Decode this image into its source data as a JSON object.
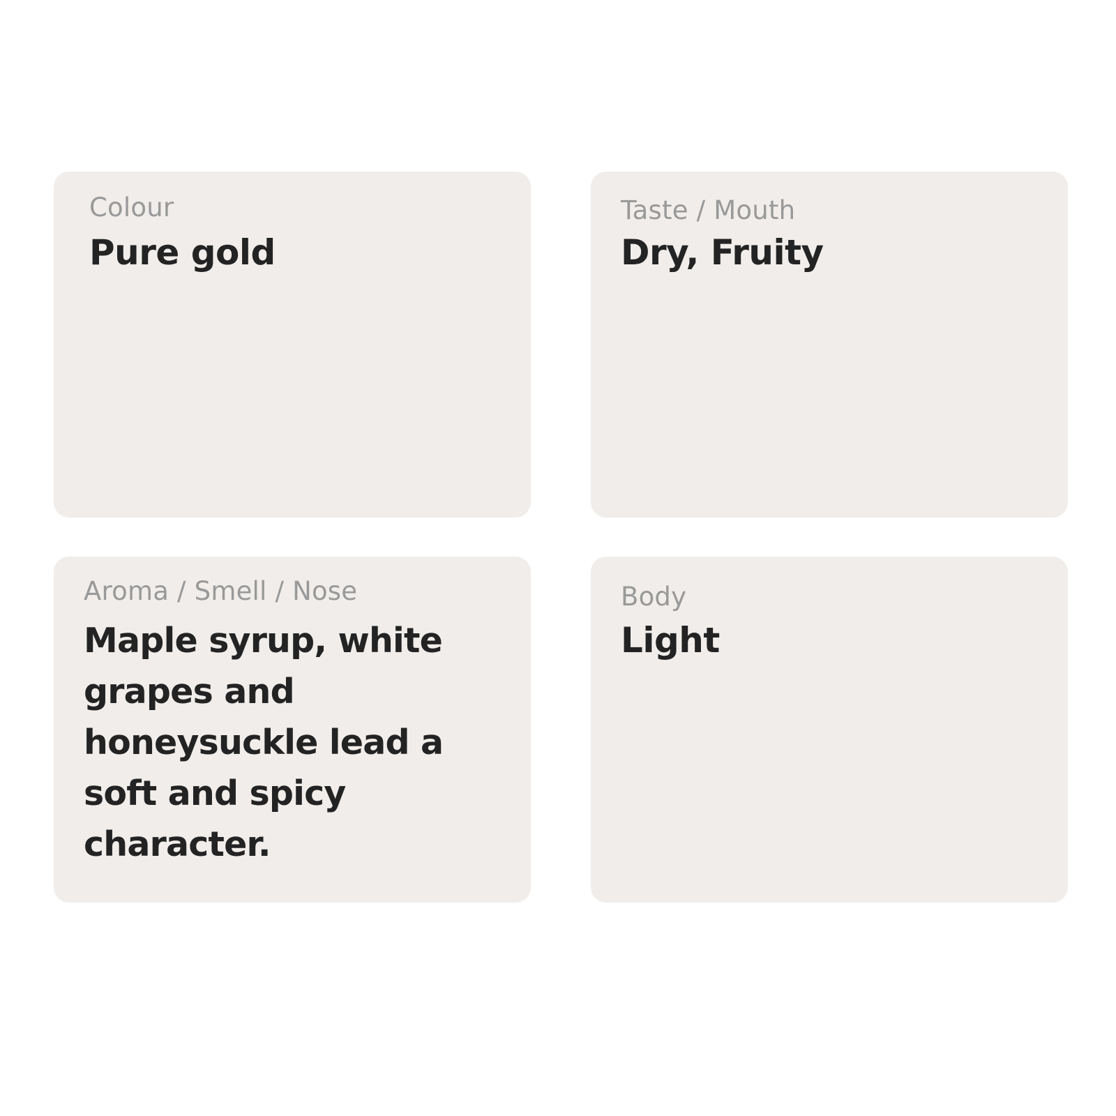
{
  "cards": [
    {
      "label": "Colour",
      "value": "Pure gold"
    },
    {
      "label": "Taste / Mouth",
      "value": "Dry, Fruity"
    },
    {
      "label": "Aroma / Smell / Nose",
      "value": "Maple syrup, white grapes and honeysuckle lead a soft and spicy character."
    },
    {
      "label": "Body",
      "value": "Light"
    }
  ],
  "colors": {
    "background": "#ffffff",
    "card_background": "#f0edea",
    "label_text": "#999999",
    "value_text": "#232323"
  }
}
